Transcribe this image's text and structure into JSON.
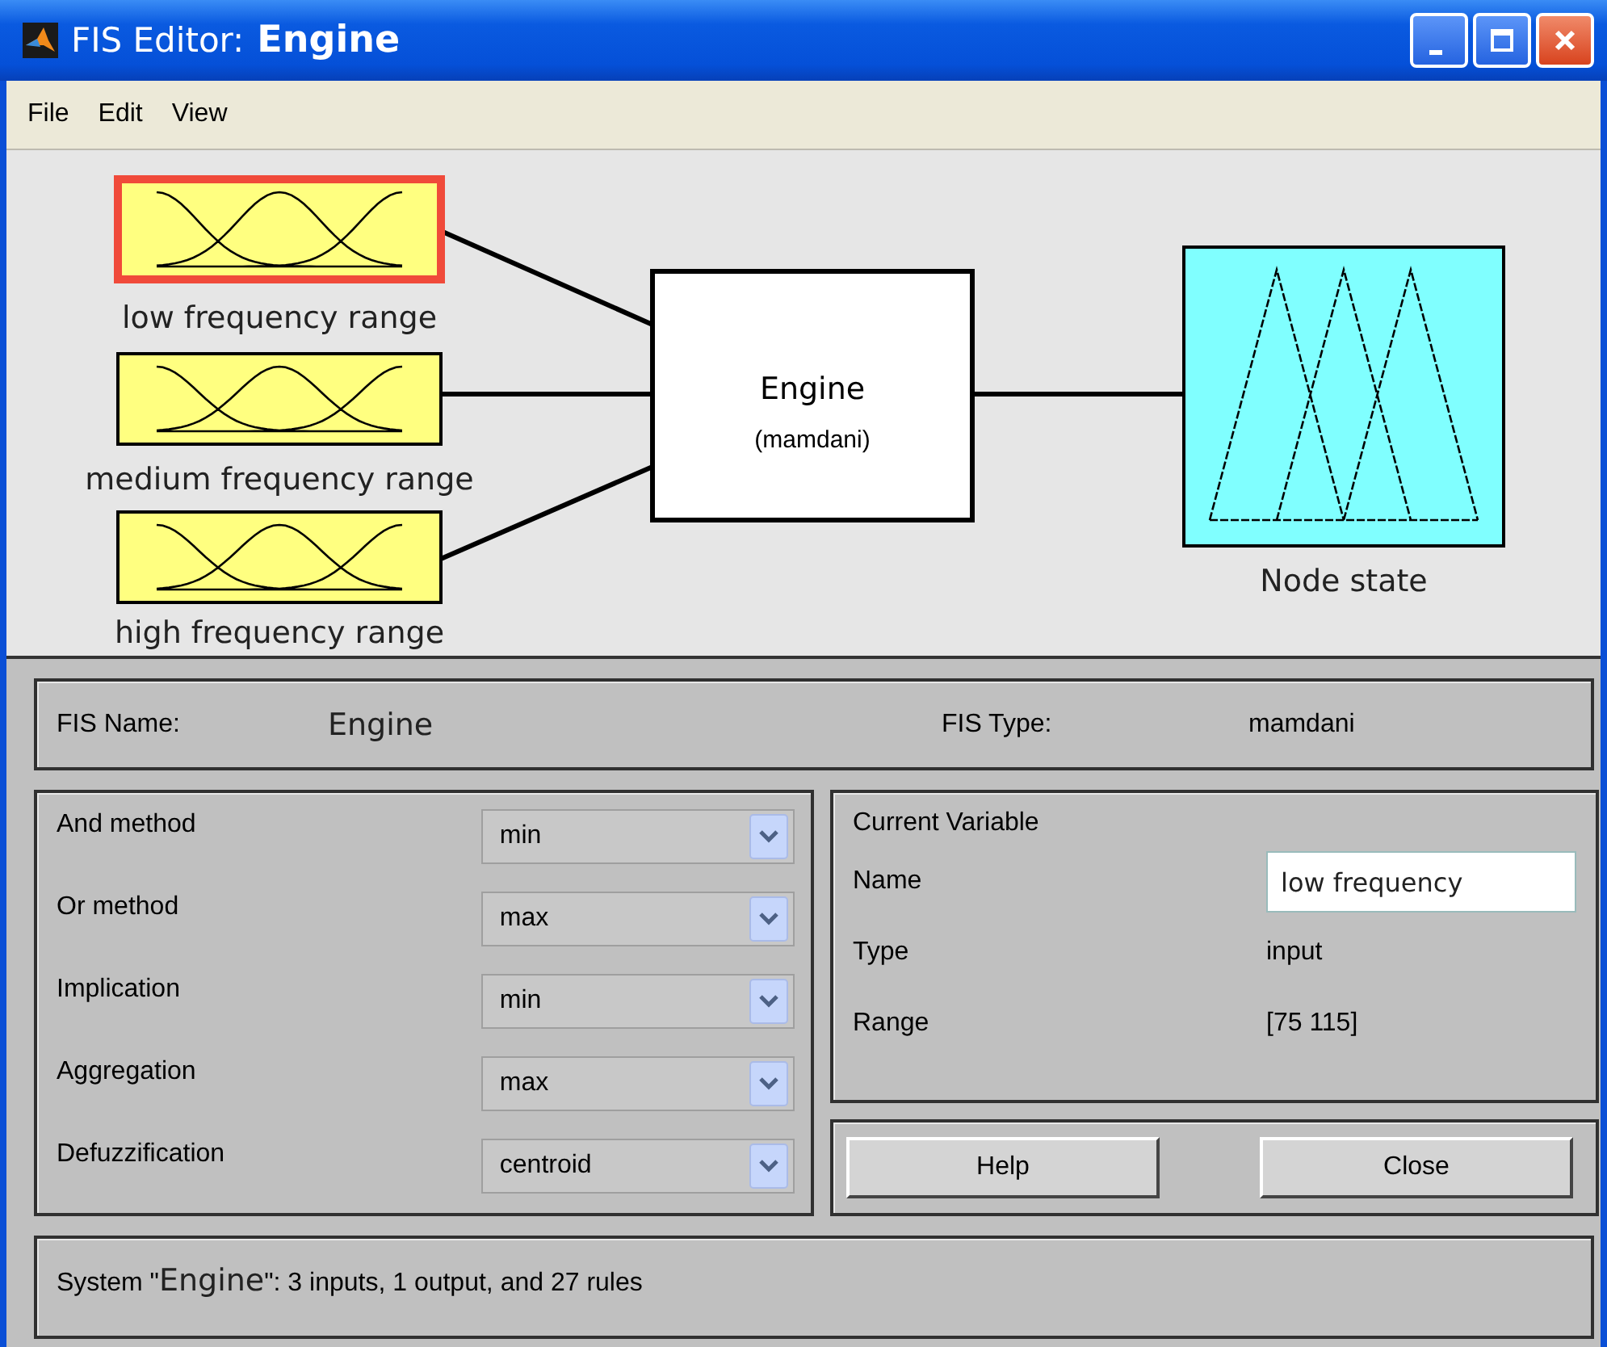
{
  "window": {
    "title_prefix": "FIS Editor:",
    "title": "Engine"
  },
  "menu": [
    "File",
    "Edit",
    "View"
  ],
  "diagram": {
    "inputs": [
      {
        "label": "low frequency range",
        "selected": true
      },
      {
        "label": "medium frequency range",
        "selected": false
      },
      {
        "label": "high frequency range",
        "selected": false
      }
    ],
    "system": {
      "name": "Engine",
      "type": "(mamdani)"
    },
    "output": {
      "label": "Node state",
      "selected": false
    }
  },
  "info": {
    "fis_name_label": "FIS Name:",
    "fis_name": "Engine",
    "fis_type_label": "FIS Type:",
    "fis_type": "mamdani"
  },
  "methods": [
    {
      "label": "And method",
      "value": "min"
    },
    {
      "label": "Or method",
      "value": "max"
    },
    {
      "label": "Implication",
      "value": "min"
    },
    {
      "label": "Aggregation",
      "value": "max"
    },
    {
      "label": "Defuzzification",
      "value": "centroid"
    }
  ],
  "current_variable": {
    "title": "Current Variable",
    "fields": [
      {
        "label": "Name",
        "value": "low frequency",
        "kind": "field"
      },
      {
        "label": "Type",
        "value": "input",
        "kind": "text"
      },
      {
        "label": "Range",
        "value": "[75 115]",
        "kind": "text"
      }
    ]
  },
  "buttons": [
    "Help",
    "Close"
  ],
  "status": {
    "before": "System \"",
    "name": "Engine",
    "after": "\": 3 inputs, 1 output, and 27 rules"
  }
}
